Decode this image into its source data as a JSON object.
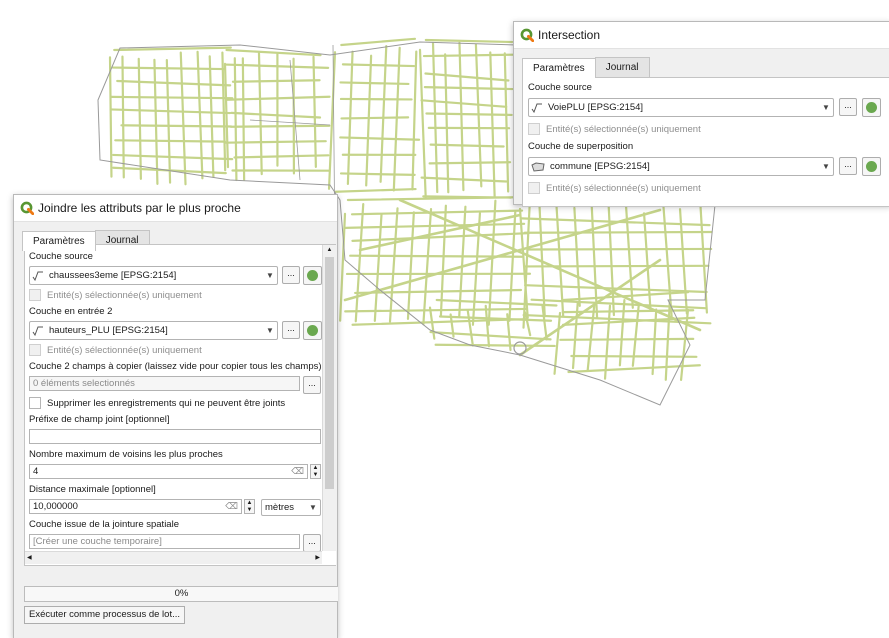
{
  "colors": {
    "road": "#c5d48a",
    "road_dark": "#8c9a55",
    "outline": "#9a9a9a",
    "qgis_green": "#589632",
    "qgis_yellow": "#ee7913"
  },
  "dialog_join": {
    "title": "Joindre les attributs par le plus proche",
    "tabs": [
      "Paramètres",
      "Journal"
    ],
    "source_label": "Couche source",
    "source_value": "chaussees3eme [EPSG:2154]",
    "selected_only_1": "Entité(s) sélectionnée(s) uniquement",
    "input2_label": "Couche en entrée 2",
    "input2_value": "hauteurs_PLU [EPSG:2154]",
    "selected_only_2": "Entité(s) sélectionnée(s) uniquement",
    "fields_label": "Couche 2 champs à copier (laissez vide pour copier tous les champs) [optional]",
    "fields_value": "0 éléments selectionnés",
    "discard_label": "Supprimer les enregistrements qui ne peuvent être joints",
    "prefix_label": "Préfixe de champ joint [optionnel]",
    "prefix_value": "",
    "neighbors_label": "Nombre maximum de voisins les plus proches",
    "neighbors_value": "4",
    "distance_label": "Distance maximale [optionnel]",
    "distance_value": "10,000000",
    "unit_value": "mètres",
    "output_label": "Couche issue de la jointure spatiale",
    "output_placeholder": "[Créer une couche temporaire]",
    "progress_value": 0,
    "progress_text": "0%",
    "batch_button": "Exécuter comme processus de lot...",
    "ellipsis": "..."
  },
  "dialog_intersection": {
    "title": "Intersection",
    "tabs": [
      "Paramètres",
      "Journal"
    ],
    "source_label": "Couche source",
    "source_value": "VoiePLU [EPSG:2154]",
    "selected_only_1": "Entité(s) sélectionnée(s) uniquement",
    "overlay_label": "Couche de superposition",
    "overlay_value": "commune [EPSG:2154]",
    "selected_only_2": "Entité(s) sélectionnée(s) uniquement",
    "ellipsis": "..."
  }
}
